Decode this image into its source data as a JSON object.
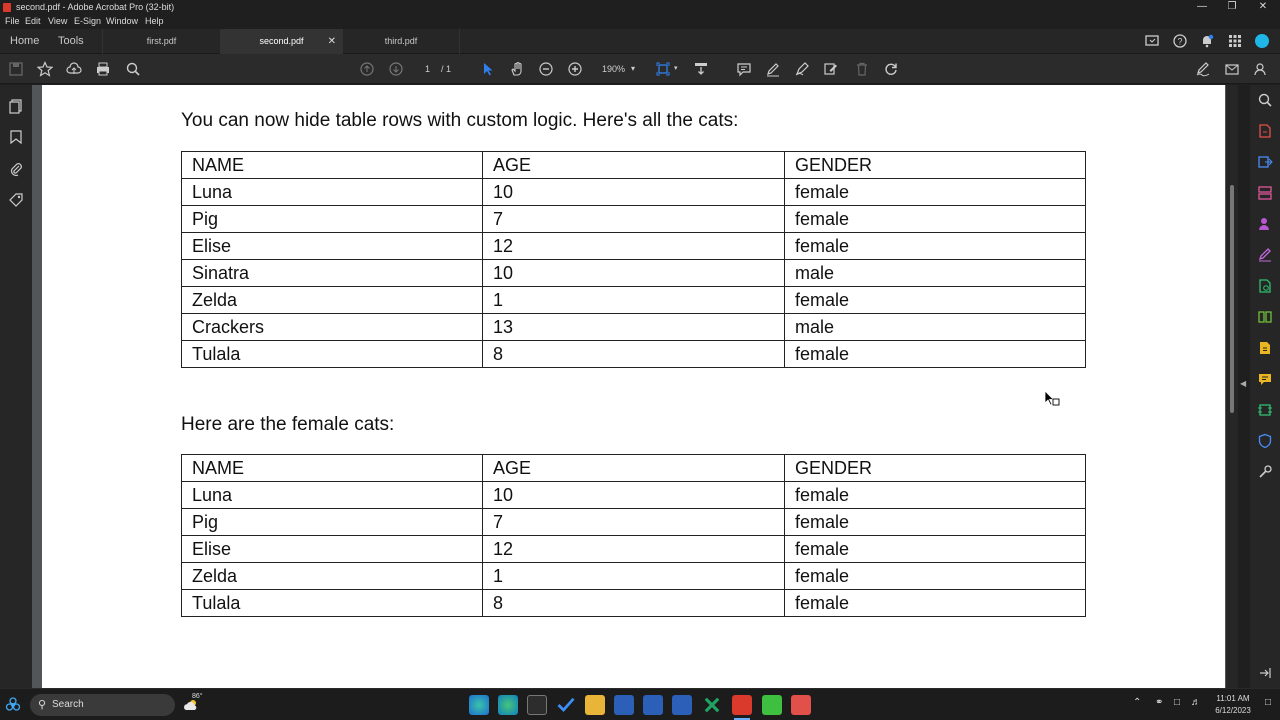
{
  "window": {
    "title": "second.pdf - Adobe Acrobat Pro (32-bit)"
  },
  "menu": {
    "items": [
      "File",
      "Edit",
      "View",
      "E-Sign",
      "Window",
      "Help"
    ]
  },
  "nav": {
    "home": "Home",
    "tools": "Tools"
  },
  "tabs": [
    {
      "label": "first.pdf",
      "active": false
    },
    {
      "label": "second.pdf",
      "active": true
    },
    {
      "label": "third.pdf",
      "active": false
    }
  ],
  "toolbar": {
    "page_current": "1",
    "page_total": "/ 1",
    "zoom": "190%"
  },
  "document": {
    "intro_text": "You can now hide table rows with custom logic. Here's all the cats:",
    "female_text": "Here are the female cats:",
    "headers": [
      "NAME",
      "AGE",
      "GENDER"
    ],
    "all_cats": [
      [
        "Luna",
        "10",
        "female"
      ],
      [
        "Pig",
        "7",
        "female"
      ],
      [
        "Elise",
        "12",
        "female"
      ],
      [
        "Sinatra",
        "10",
        "male"
      ],
      [
        "Zelda",
        "1",
        "female"
      ],
      [
        "Crackers",
        "13",
        "male"
      ],
      [
        "Tulala",
        "8",
        "female"
      ]
    ],
    "female_cats": [
      [
        "Luna",
        "10",
        "female"
      ],
      [
        "Pig",
        "7",
        "female"
      ],
      [
        "Elise",
        "12",
        "female"
      ],
      [
        "Zelda",
        "1",
        "female"
      ],
      [
        "Tulala",
        "8",
        "female"
      ]
    ]
  },
  "taskbar": {
    "search": "Search",
    "weather_temp": "86°",
    "time": "11:01 AM",
    "date": "6/12/2023"
  },
  "colors": {
    "accent_red": "#d93a2b",
    "accent_blue": "#2f80ed"
  }
}
